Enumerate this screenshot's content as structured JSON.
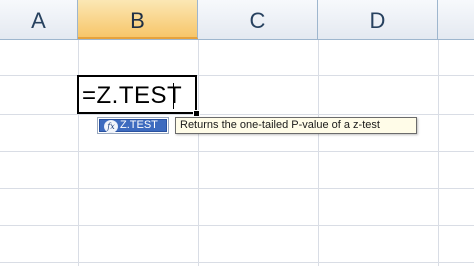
{
  "columns": [
    "A",
    "B",
    "C",
    "D"
  ],
  "active_column": "B",
  "active_cell": {
    "value": "=Z.TEST"
  },
  "autocomplete": {
    "items": [
      {
        "label": "Z.TEST",
        "icon": "function-icon",
        "selected": true
      }
    ]
  },
  "tooltip": {
    "text": "Returns the one-tailed P-value of a z-test"
  },
  "colors": {
    "selected_header": "#f7c66a",
    "selected_item": "#3d6bbf",
    "tooltip_bg": "#fffce8"
  }
}
